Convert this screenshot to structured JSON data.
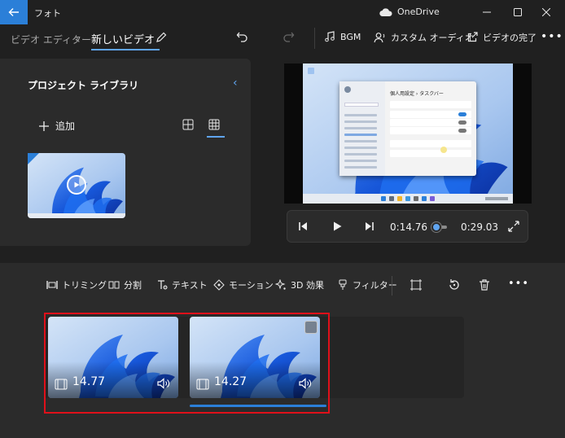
{
  "titlebar": {
    "app_title": "フォト",
    "onedrive_label": "OneDrive"
  },
  "header": {
    "breadcrumb_root": "ビデオ エディター",
    "breadcrumb_current": "新しいビデオ",
    "bgm_label": "BGM",
    "custom_audio_label": "カスタム オーディオ",
    "finish_label": "ビデオの完了"
  },
  "library": {
    "title": "プロジェクト ライブラリ",
    "add_label": "追加"
  },
  "preview": {
    "settings_title": "個人用設定 › タスクバー"
  },
  "playback": {
    "current_time": "0:14.76",
    "total_time": "0:29.03",
    "progress": 0.508
  },
  "toolbar": {
    "trim": "トリミング",
    "split": "分割",
    "text": "テキスト",
    "motion": "モーション",
    "effects3d": "3D 効果",
    "filter": "フィルター"
  },
  "storyboard": {
    "clips": [
      {
        "duration": "14.77"
      },
      {
        "duration": "14.27"
      }
    ]
  },
  "colors": {
    "accent": "#2b7fd8",
    "accent_light": "#60a5f0",
    "selection": "#e0101a",
    "panel": "#2b2b2b",
    "background": "#202020"
  }
}
